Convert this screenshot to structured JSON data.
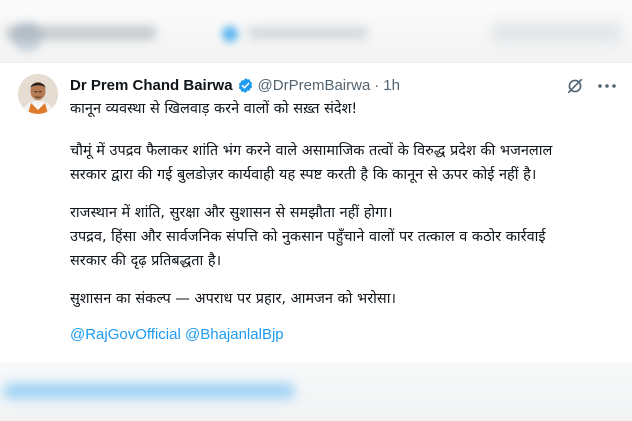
{
  "post": {
    "author_name": "Dr Prem Chand Bairwa",
    "handle": "@DrPremBairwa",
    "separator": "·",
    "time": "1h",
    "body": {
      "headline": "कानून व्यवस्था से खिलवाड़ करने वालों को सख़्त संदेश!",
      "para1_line1": "चौमूं में उपद्रव फैलाकर शांति भंग करने वाले असामाजिक तत्वों के विरुद्ध प्रदेश की भजनलाल",
      "para1_line2": "सरकार द्वारा की गई बुलडोज़र कार्यवाही यह स्पष्ट करती है कि कानून से ऊपर कोई नहीं है।",
      "para2_line1": "राजस्थान में शांति, सुरक्षा और सुशासन से समझौता नहीं होगा।",
      "para2_line2": "उपद्रव, हिंसा और सार्वजनिक संपत्ति को नुकसान पहुँचाने वालों पर तत्काल व कठोर कार्रवाई",
      "para2_line3": "सरकार की दृढ़ प्रतिबद्धता है।",
      "para3": "सुशासन का संकल्प — अपराध पर प्रहार, आमजन को भरोसा।"
    },
    "mentions": [
      "@RajGovOfficial",
      "@BhajanlalBjp"
    ]
  },
  "icons": {
    "verified": "verified-badge-icon",
    "grok": "grok-icon",
    "more": "more-options-icon"
  },
  "colors": {
    "link": "#1d9bf0",
    "text": "#0f1419",
    "muted": "#536471"
  }
}
